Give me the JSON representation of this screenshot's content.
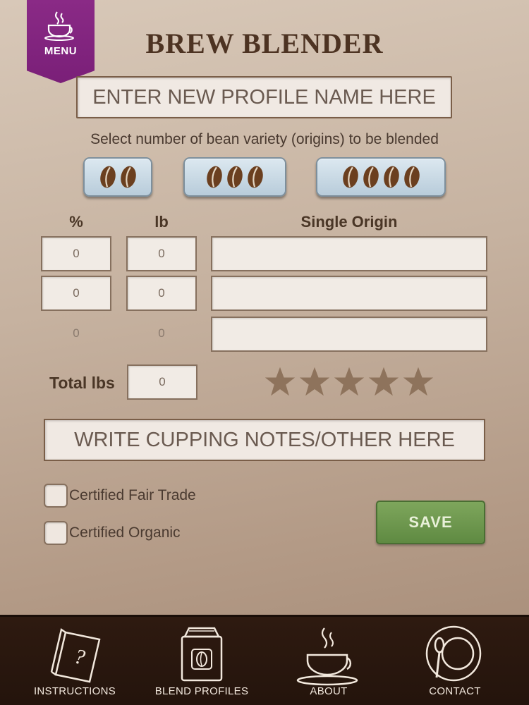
{
  "menu": {
    "label": "MENU",
    "icon": "coffee-cup-icon",
    "color": "#7a1f78"
  },
  "header": {
    "title": "BREW BLENDER"
  },
  "profile": {
    "placeholder": "ENTER NEW PROFILE NAME HERE"
  },
  "bean_select": {
    "caption": "Select number of bean variety (origins) to be blended",
    "options": [
      {
        "count": 2,
        "icon": "coffee-bean-icon"
      },
      {
        "count": 3,
        "icon": "coffee-bean-icon"
      },
      {
        "count": 4,
        "icon": "coffee-bean-icon"
      }
    ]
  },
  "blend_table": {
    "headers": {
      "percent": "%",
      "lb": "lb",
      "origin": "Single Origin"
    },
    "rows": [
      {
        "percent": "0",
        "lb": "0",
        "origin": ""
      },
      {
        "percent": "0",
        "lb": "0",
        "origin": ""
      },
      {
        "percent": "0",
        "lb": "0",
        "origin": ""
      }
    ]
  },
  "total": {
    "label": "Total lbs",
    "value": "0"
  },
  "rating": {
    "stars": 5,
    "filled": 0,
    "icon": "star-icon"
  },
  "notes": {
    "placeholder": "WRITE CUPPING NOTES/OTHER HERE"
  },
  "certifications": [
    {
      "label": "Certified Fair Trade",
      "checked": false
    },
    {
      "label": "Certified Organic",
      "checked": false
    }
  ],
  "save": {
    "label": "SAVE",
    "color": "#6a9a4a"
  },
  "tabbar": [
    {
      "label": "INSTRUCTIONS",
      "icon": "book-question-icon"
    },
    {
      "label": "BLEND PROFILES",
      "icon": "coffee-bag-icon"
    },
    {
      "label": "ABOUT",
      "icon": "steaming-cup-icon"
    },
    {
      "label": "CONTACT",
      "icon": "plate-spoon-icon"
    }
  ]
}
